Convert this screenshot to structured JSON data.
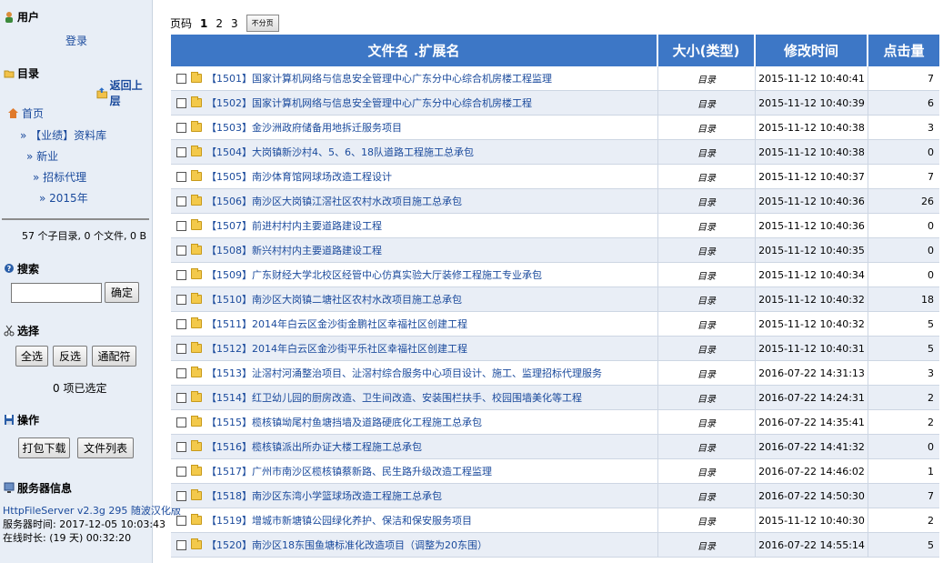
{
  "sidebar": {
    "user": {
      "title": "用户",
      "login": "登录"
    },
    "dir": {
      "title": "目录",
      "back": "返回上层",
      "crumbs": [
        "首页",
        "» 【业绩】资料库",
        "» 新业",
        "» 招标代理",
        "» 2015年"
      ],
      "summary": "57 个子目录, 0 个文件, 0 B"
    },
    "search": {
      "title": "搜索",
      "button": "确定",
      "value": ""
    },
    "select": {
      "title": "选择",
      "all": "全选",
      "invert": "反选",
      "wildcard": "通配符",
      "count": "0 项已选定"
    },
    "ops": {
      "title": "操作",
      "zip": "打包下载",
      "filelist": "文件列表"
    },
    "server": {
      "title": "服务器信息",
      "version": "HttpFileServer v2.3g 295 随波汉化版",
      "time": "服务器时间: 2017-12-05 10:03:43",
      "uptime": "在线时长: (19 天) 00:32:20"
    }
  },
  "pager": {
    "label": "页码",
    "current": "1",
    "p2": "2",
    "p3": "3",
    "nopage": "不分页"
  },
  "table": {
    "headers": {
      "name": "文件名 .扩展名",
      "size": "大小(类型)",
      "mtime": "修改时间",
      "hits": "点击量"
    },
    "rows": [
      {
        "name": "【1501】国家计算机网络与信息安全管理中心广东分中心综合机房楼工程监理",
        "type": "目录",
        "time": "2015-11-12 10:40:41",
        "hits": "7"
      },
      {
        "name": "【1502】国家计算机网络与信息安全管理中心广东分中心综合机房楼工程",
        "type": "目录",
        "time": "2015-11-12 10:40:39",
        "hits": "6"
      },
      {
        "name": "【1503】金沙洲政府储备用地拆迁服务项目",
        "type": "目录",
        "time": "2015-11-12 10:40:38",
        "hits": "3"
      },
      {
        "name": "【1504】大岗镇新沙村4、5、6、18队道路工程施工总承包",
        "type": "目录",
        "time": "2015-11-12 10:40:38",
        "hits": "0"
      },
      {
        "name": "【1505】南沙体育馆网球场改造工程设计",
        "type": "目录",
        "time": "2015-11-12 10:40:37",
        "hits": "7"
      },
      {
        "name": "【1506】南沙区大岗镇江滘社区农村水改项目施工总承包",
        "type": "目录",
        "time": "2015-11-12 10:40:36",
        "hits": "26"
      },
      {
        "name": "【1507】前进村村内主要道路建设工程",
        "type": "目录",
        "time": "2015-11-12 10:40:36",
        "hits": "0"
      },
      {
        "name": "【1508】新兴村村内主要道路建设工程",
        "type": "目录",
        "time": "2015-11-12 10:40:35",
        "hits": "0"
      },
      {
        "name": "【1509】广东财经大学北校区经管中心仿真实验大厅装修工程施工专业承包",
        "type": "目录",
        "time": "2015-11-12 10:40:34",
        "hits": "0"
      },
      {
        "name": "【1510】南沙区大岗镇二塘社区农村水改项目施工总承包",
        "type": "目录",
        "time": "2015-11-12 10:40:32",
        "hits": "18"
      },
      {
        "name": "【1511】2014年白云区金沙街金鹏社区幸福社区创建工程",
        "type": "目录",
        "time": "2015-11-12 10:40:32",
        "hits": "5"
      },
      {
        "name": "【1512】2014年白云区金沙街平乐社区幸福社区创建工程",
        "type": "目录",
        "time": "2015-11-12 10:40:31",
        "hits": "5"
      },
      {
        "name": "【1513】沚滘村河涌整治项目、沚滘村综合服务中心项目设计、施工、监理招标代理服务",
        "type": "目录",
        "time": "2016-07-22 14:31:13",
        "hits": "3"
      },
      {
        "name": "【1514】红卫幼儿园的厨房改造、卫生间改造、安装围栏扶手、校园围墙美化等工程",
        "type": "目录",
        "time": "2016-07-22 14:24:31",
        "hits": "2"
      },
      {
        "name": "【1515】榄核镇坳尾村鱼塘挡墙及道路硬底化工程施工总承包",
        "type": "目录",
        "time": "2016-07-22 14:35:41",
        "hits": "2"
      },
      {
        "name": "【1516】榄核镇派出所办证大楼工程施工总承包",
        "type": "目录",
        "time": "2016-07-22 14:41:32",
        "hits": "0"
      },
      {
        "name": "【1517】广州市南沙区榄核镇蔡新路、民生路升级改造工程监理",
        "type": "目录",
        "time": "2016-07-22 14:46:02",
        "hits": "1"
      },
      {
        "name": "【1518】南沙区东湾小学篮球场改造工程施工总承包",
        "type": "目录",
        "time": "2016-07-22 14:50:30",
        "hits": "7"
      },
      {
        "name": "【1519】增城市新塘镇公园绿化养护、保洁和保安服务项目",
        "type": "目录",
        "time": "2015-11-12 10:40:30",
        "hits": "2"
      },
      {
        "name": "【1520】南沙区18东围鱼塘标准化改造项目（调整为20东围）",
        "type": "目录",
        "time": "2016-07-22 14:55:14",
        "hits": "5"
      }
    ]
  }
}
